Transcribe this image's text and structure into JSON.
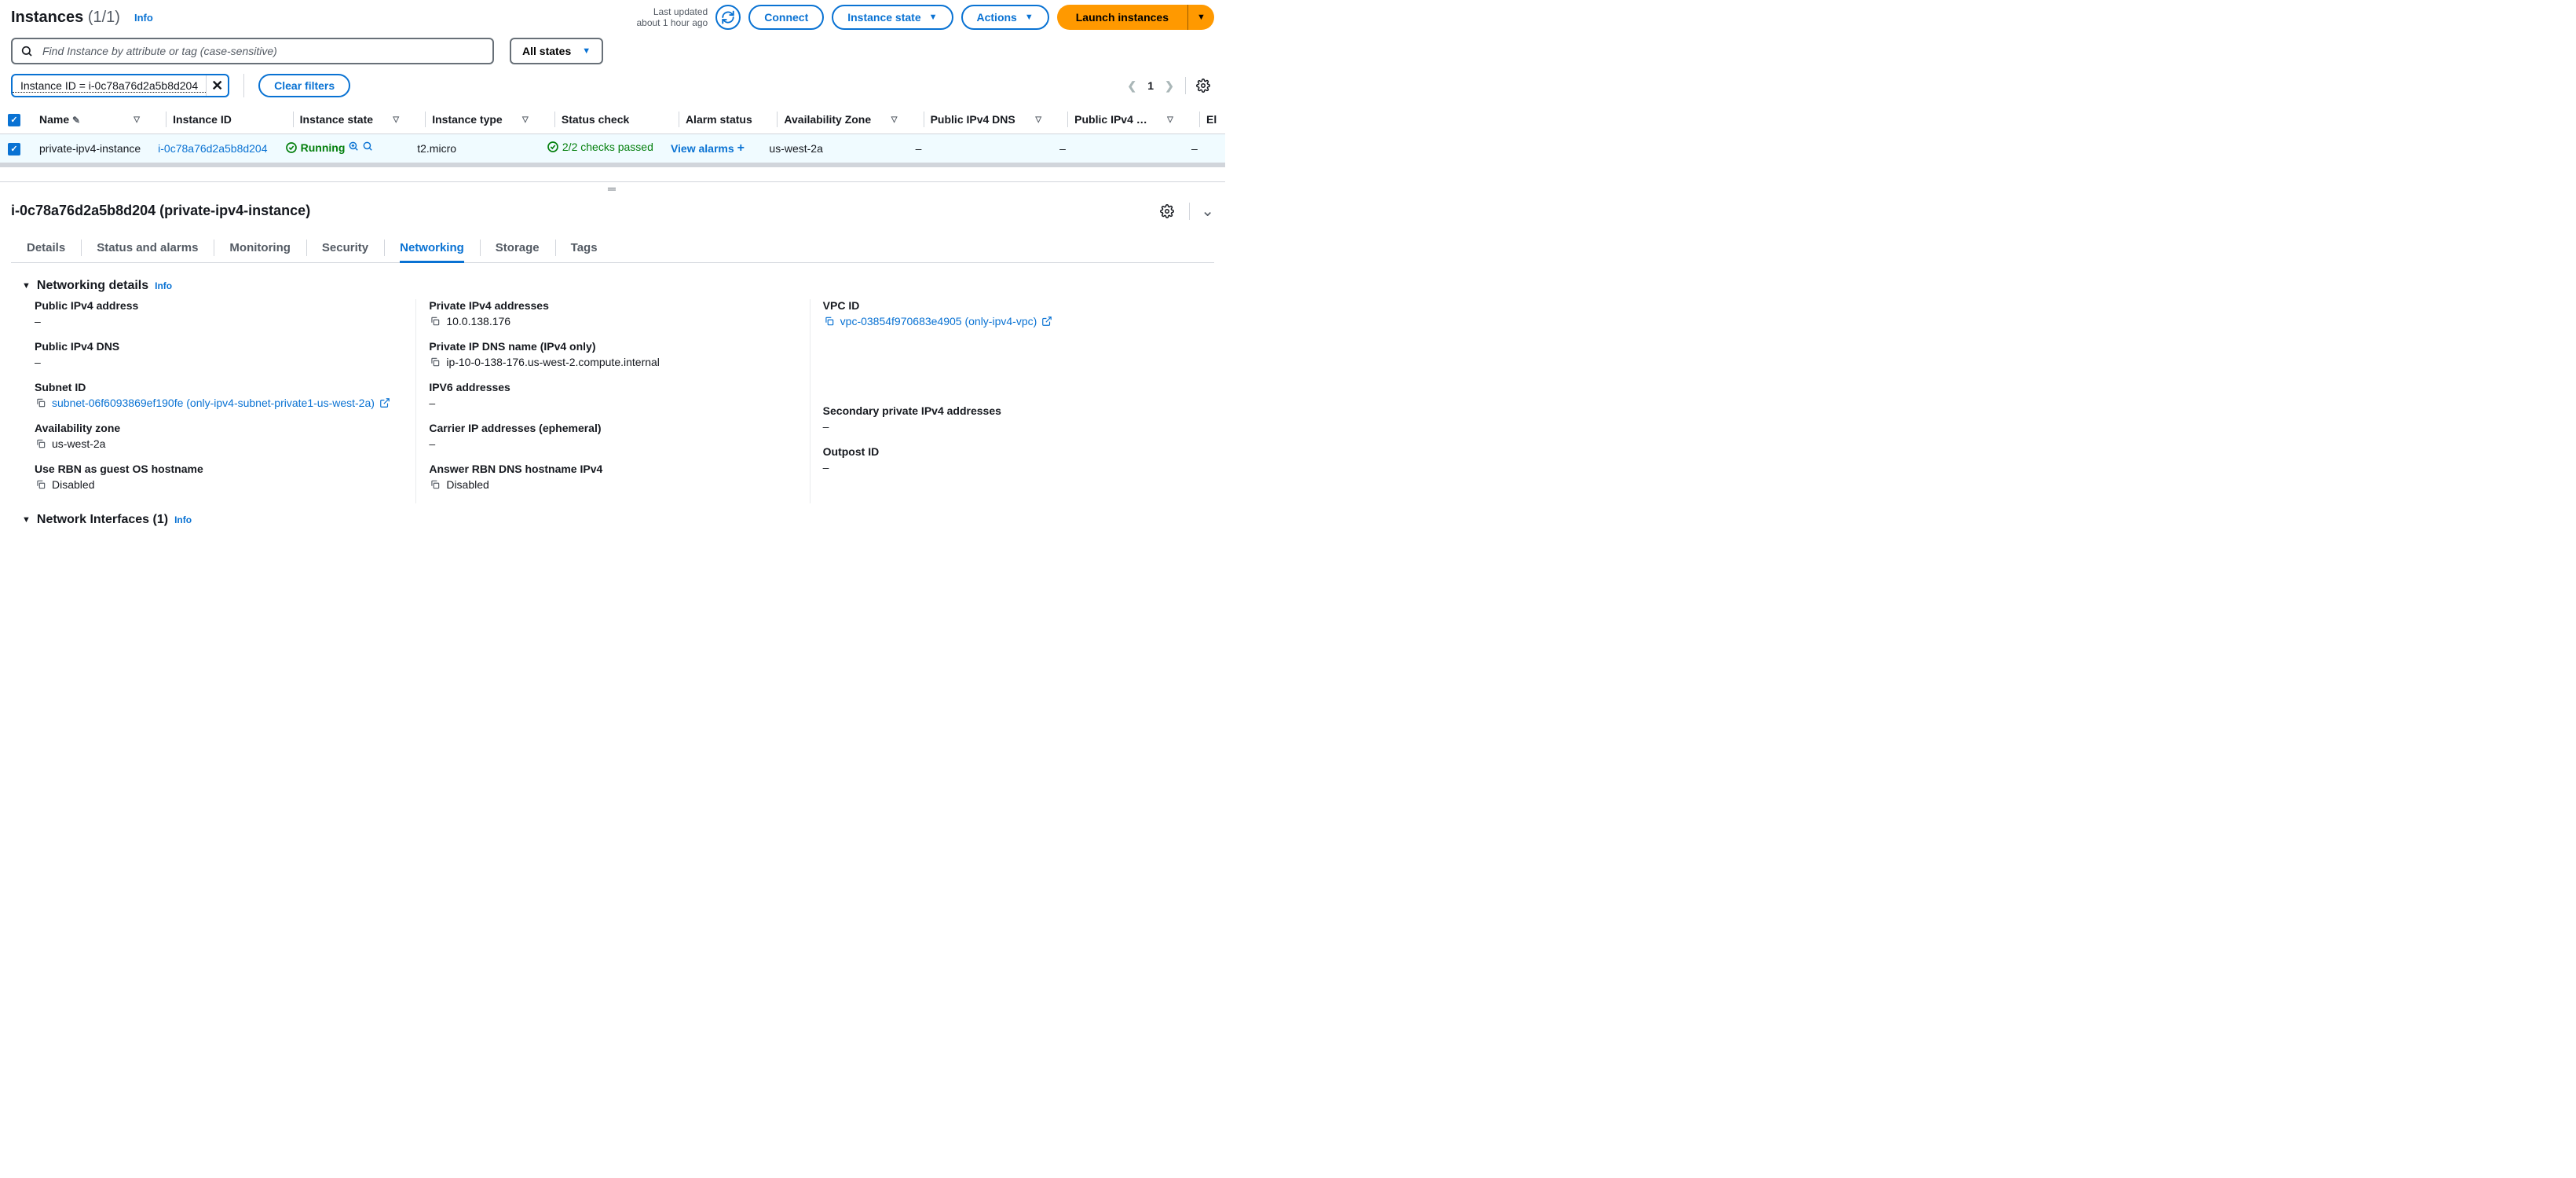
{
  "header": {
    "title": "Instances",
    "count": "(1/1)",
    "info": "Info",
    "lastUpdatedLabel": "Last updated",
    "lastUpdatedAgo": "about 1 hour ago",
    "connect": "Connect",
    "instanceState": "Instance state",
    "actions": "Actions",
    "launch": "Launch instances"
  },
  "search": {
    "placeholder": "Find Instance by attribute or tag (case-sensitive)",
    "allStates": "All states"
  },
  "filters": {
    "chip": "Instance ID = i-0c78a76d2a5b8d204",
    "clear": "Clear filters",
    "page": "1"
  },
  "columns": {
    "name": "Name",
    "instanceId": "Instance ID",
    "instanceState": "Instance state",
    "instanceType": "Instance type",
    "statusCheck": "Status check",
    "alarmStatus": "Alarm status",
    "az": "Availability Zone",
    "publicDns": "Public IPv4 DNS",
    "publicIp": "Public IPv4 …",
    "el": "El"
  },
  "row": {
    "name": "private-ipv4-instance",
    "instanceId": "i-0c78a76d2a5b8d204",
    "state": "Running",
    "type": "t2.micro",
    "statusCheck": "2/2 checks passed",
    "alarm": "View alarms",
    "alarmPlus": "+",
    "az": "us-west-2a",
    "publicDns": "–",
    "publicIp": "–",
    "el": "–"
  },
  "details": {
    "title": "i-0c78a76d2a5b8d204 (private-ipv4-instance)"
  },
  "tabs": [
    "Details",
    "Status and alarms",
    "Monitoring",
    "Security",
    "Networking",
    "Storage",
    "Tags"
  ],
  "networking": {
    "sectionTitle": "Networking details",
    "sectionInfo": "Info",
    "niTitle": "Network Interfaces (1)",
    "niInfo": "Info",
    "col0": {
      "publicIpLabel": "Public IPv4 address",
      "publicIpVal": "–",
      "publicDnsLabel": "Public IPv4 DNS",
      "publicDnsVal": "–",
      "subnetLabel": "Subnet ID",
      "subnetVal": "subnet-06f6093869ef190fe (only-ipv4-subnet-private1-us-west-2a)",
      "azLabel": "Availability zone",
      "azVal": "us-west-2a",
      "rbnLabel": "Use RBN as guest OS hostname",
      "rbnVal": "Disabled"
    },
    "col1": {
      "privIpLabel": "Private IPv4 addresses",
      "privIpVal": "10.0.138.176",
      "privDnsLabel": "Private IP DNS name (IPv4 only)",
      "privDnsVal": "ip-10-0-138-176.us-west-2.compute.internal",
      "ipv6Label": "IPV6 addresses",
      "ipv6Val": "–",
      "carrierLabel": "Carrier IP addresses (ephemeral)",
      "carrierVal": "–",
      "ansRbnLabel": "Answer RBN DNS hostname IPv4",
      "ansRbnVal": "Disabled"
    },
    "col2": {
      "vpcLabel": "VPC ID",
      "vpcVal": "vpc-03854f970683e4905 (only-ipv4-vpc)",
      "secIpLabel": "Secondary private IPv4 addresses",
      "secIpVal": "–",
      "outpostLabel": "Outpost ID",
      "outpostVal": "–"
    }
  }
}
